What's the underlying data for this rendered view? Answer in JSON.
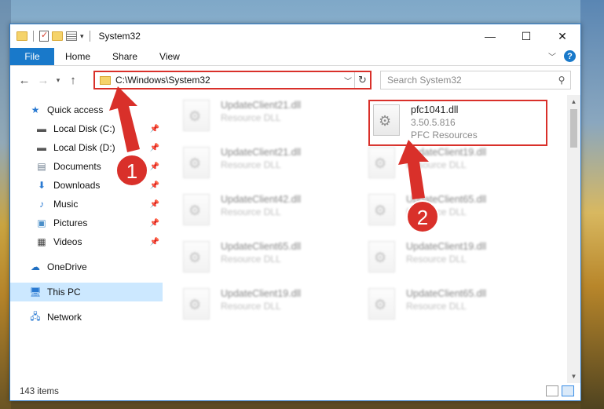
{
  "window": {
    "title": "System32",
    "controls": {
      "minimize": "—",
      "maximize": "☐",
      "close": "✕"
    }
  },
  "ribbon": {
    "tabs": [
      "File",
      "Home",
      "Share",
      "View"
    ],
    "help": "?"
  },
  "address": {
    "path": "C:\\Windows\\System32",
    "refresh": "↻"
  },
  "search": {
    "placeholder": "Search System32"
  },
  "sidebar": {
    "quick_access": "Quick access",
    "items": [
      {
        "label": "Local Disk (C:)",
        "icon": "drive-icon"
      },
      {
        "label": "Local Disk (D:)",
        "icon": "drive-icon"
      },
      {
        "label": "Documents",
        "icon": "documents-icon"
      },
      {
        "label": "Downloads",
        "icon": "downloads-icon"
      },
      {
        "label": "Music",
        "icon": "music-icon"
      },
      {
        "label": "Pictures",
        "icon": "pictures-icon"
      },
      {
        "label": "Videos",
        "icon": "videos-icon"
      }
    ],
    "onedrive": "OneDrive",
    "this_pc": "This PC",
    "network": "Network"
  },
  "files": {
    "highlight": {
      "name": "pfc1041.dll",
      "version": "3.50.5.816",
      "description": "PFC Resources"
    },
    "left_column": [
      {
        "name": "UpdateClient21.dll",
        "sub": "Resource DLL"
      },
      {
        "name": "UpdateClient21.dll",
        "sub": "Resource DLL"
      },
      {
        "name": "UpdateClient42.dll",
        "sub": "Resource DLL"
      },
      {
        "name": "UpdateClient65.dll",
        "sub": "Resource DLL"
      },
      {
        "name": "UpdateClient19.dll",
        "sub": "Resource DLL"
      }
    ],
    "right_column": [
      {
        "name": "UpdateClient19.dll",
        "sub": "Resource DLL"
      },
      {
        "name": "UpdateClient65.dll",
        "sub": "Resource DLL"
      },
      {
        "name": "UpdateClient19.dll",
        "sub": "Resource DLL"
      },
      {
        "name": "UpdateClient65.dll",
        "sub": "Resource DLL"
      }
    ]
  },
  "status": {
    "item_count": "143 items"
  },
  "annotations": {
    "step1": "1",
    "step2": "2",
    "color": "#d9302a"
  }
}
